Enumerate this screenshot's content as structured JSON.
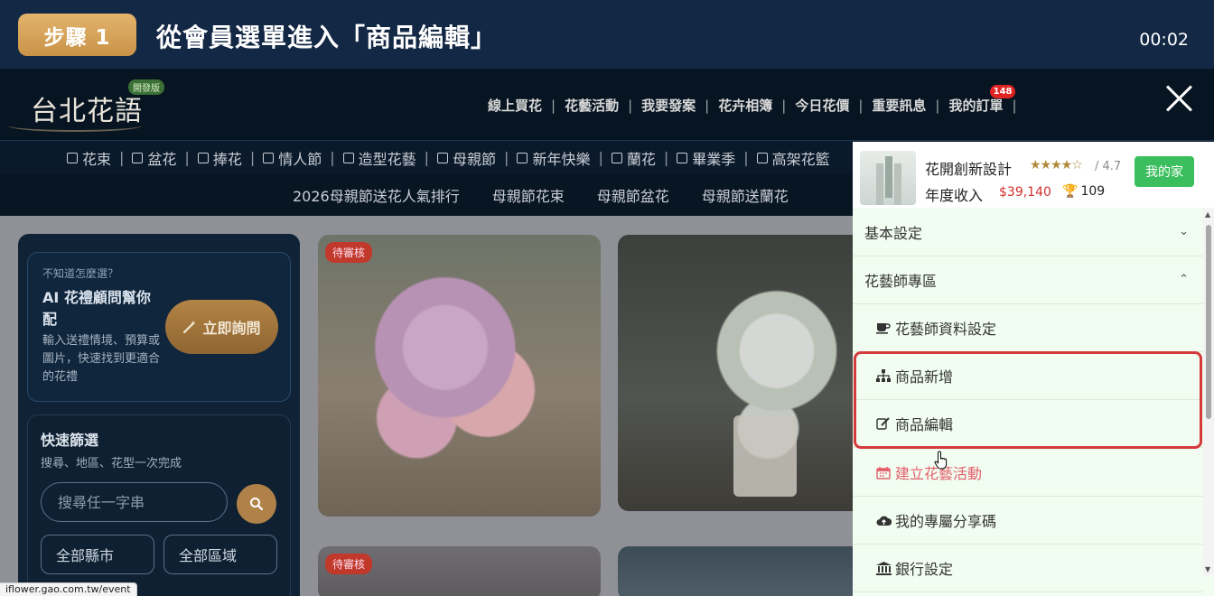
{
  "banner": {
    "step": "步驟 1",
    "title": "從會員選單進入「商品編輯」",
    "timer": "00:02"
  },
  "logo": {
    "text": "台北花語",
    "badge": "開發版"
  },
  "topnav": {
    "items": [
      "線上買花",
      "花藝活動",
      "我要發案",
      "花卉相簿",
      "今日花價",
      "重要訊息",
      "我的訂單"
    ],
    "separator": "|",
    "order_badge": "148"
  },
  "catbar": {
    "items": [
      "花束",
      "盆花",
      "捧花",
      "情人節",
      "造型花藝",
      "母親節",
      "新年快樂",
      "蘭花",
      "畢業季",
      "高架花籃"
    ],
    "separator": "|"
  },
  "promobar": {
    "items": [
      "2026母親節送花人氣排行",
      "母親節花束",
      "母親節盆花",
      "母親節送蘭花"
    ]
  },
  "sidebar": {
    "ai_hint": "不知道怎麼選？",
    "ai_title": "AI 花禮顧問幫你配",
    "ai_desc": "輸入送禮情境、預算或圖片，快速找到更適合的花禮",
    "ask_button": "立即詢問",
    "filter_title": "快速篩選",
    "filter_sub": "搜尋、地區、花型一次完成",
    "search_placeholder": "搜尋任一字串",
    "city_select": "全部縣市",
    "area_select": "全部區域"
  },
  "cards": {
    "tag": "待審核"
  },
  "status_url": "iflower.gao.com.tw/event",
  "panel": {
    "profile_name": "花開創新設計",
    "stars": "★★★★☆",
    "rating": "/ 4.7",
    "home_button": "我的家",
    "income_label": "年度收入",
    "income_value": "$39,140",
    "trophy_count": "109",
    "menu": {
      "basic": "基本設定",
      "florist_zone": "花藝師專區",
      "florist_profile": "花藝師資料設定",
      "product_add": "商品新增",
      "product_edit": "商品編輯",
      "create_event": "建立花藝活動",
      "share_code": "我的專屬分享碼",
      "bank": "銀行設定"
    },
    "chevron_down": "⌄",
    "chevron_up": "⌃"
  },
  "colors": {
    "accent": "#c99347",
    "highlight": "#d53a3a",
    "panel_bg": "#f1fdf0",
    "home_button": "#3bbf5e"
  }
}
